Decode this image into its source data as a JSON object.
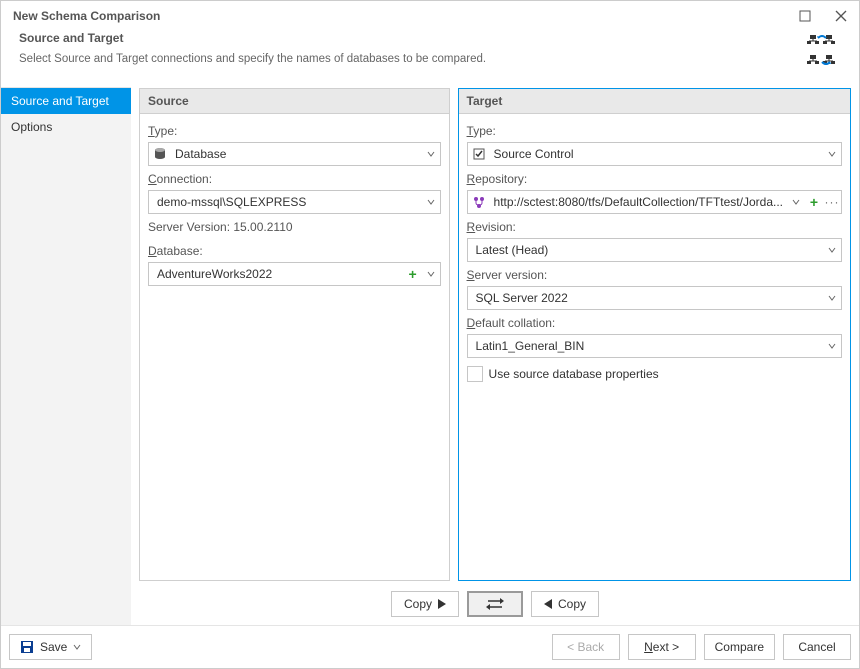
{
  "window": {
    "title": "New Schema Comparison",
    "header_title": "Source and Target",
    "header_desc": "Select Source and Target connections and specify the names of databases to be compared."
  },
  "sidebar": {
    "items": [
      {
        "label": "Source and Target",
        "active": true
      },
      {
        "label": "Options",
        "active": false
      }
    ]
  },
  "source": {
    "title": "Source",
    "type_label_prefix": "T",
    "type_label_rest": "ype:",
    "type_value": "Database",
    "connection_label_prefix": "C",
    "connection_label_rest": "onnection:",
    "connection_value": "demo-mssql\\SQLEXPRESS",
    "server_version": "Server Version: 15.00.2110",
    "database_label_prefix": "D",
    "database_label_rest": "atabase:",
    "database_value": "AdventureWorks2022"
  },
  "target": {
    "title": "Target",
    "type_label_prefix": "T",
    "type_label_rest": "ype:",
    "type_value": "Source Control",
    "repository_label_prefix": "R",
    "repository_label_rest": "epository:",
    "repository_value": "http://sctest:8080/tfs/DefaultCollection/TFTtest/Jorda...",
    "revision_label_prefix": "R",
    "revision_label_rest": "evision:",
    "revision_value": "Latest (Head)",
    "server_version_label_prefix": "S",
    "server_version_label_rest": "erver version:",
    "server_version_value": "SQL Server 2022",
    "collation_label_prefix": "D",
    "collation_label_rest": "efault collation:",
    "collation_value": "Latin1_General_BIN",
    "use_src_props": "Use source database properties"
  },
  "copy_row": {
    "copy_right": "Copy",
    "copy_left": "Copy"
  },
  "footer": {
    "save": "Save",
    "back": "< Back",
    "next_prefix": "N",
    "next_rest": "ext >",
    "compare": "Compare",
    "cancel": "Cancel"
  }
}
